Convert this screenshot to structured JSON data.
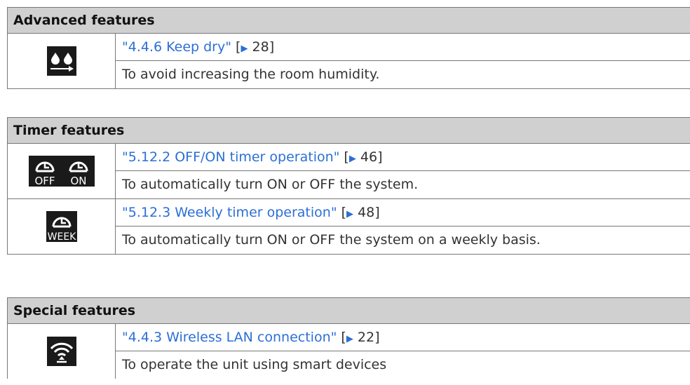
{
  "sections": [
    {
      "title": "Advanced features",
      "rows": [
        {
          "icon": "keep-dry-icon",
          "link": "\"4.4.6 Keep dry\"",
          "page": "28",
          "description": "To avoid increasing the room humidity."
        }
      ]
    },
    {
      "title": "Timer features",
      "rows": [
        {
          "icon": "off-on-timer-icon",
          "icon_labels": [
            "OFF",
            "ON"
          ],
          "link": "\"5.12.2 OFF/ON timer operation\"",
          "page": "46",
          "description": "To automatically turn ON or OFF the system."
        },
        {
          "icon": "weekly-timer-icon",
          "icon_labels": [
            "WEEK"
          ],
          "link": "\"5.12.3 Weekly timer operation\"",
          "page": "48",
          "description": "To automatically turn ON or OFF the system on a weekly basis."
        }
      ]
    },
    {
      "title": "Special features",
      "rows": [
        {
          "icon": "wireless-lan-icon",
          "link": "\"4.4.3 Wireless LAN connection\"",
          "page": "22",
          "description": "To operate the unit using smart devices"
        }
      ]
    }
  ],
  "colors": {
    "link": "#2b6fd6",
    "header_bg": "#d0d0d0",
    "icon_bg": "#1a1a1a",
    "border": "#777777"
  }
}
